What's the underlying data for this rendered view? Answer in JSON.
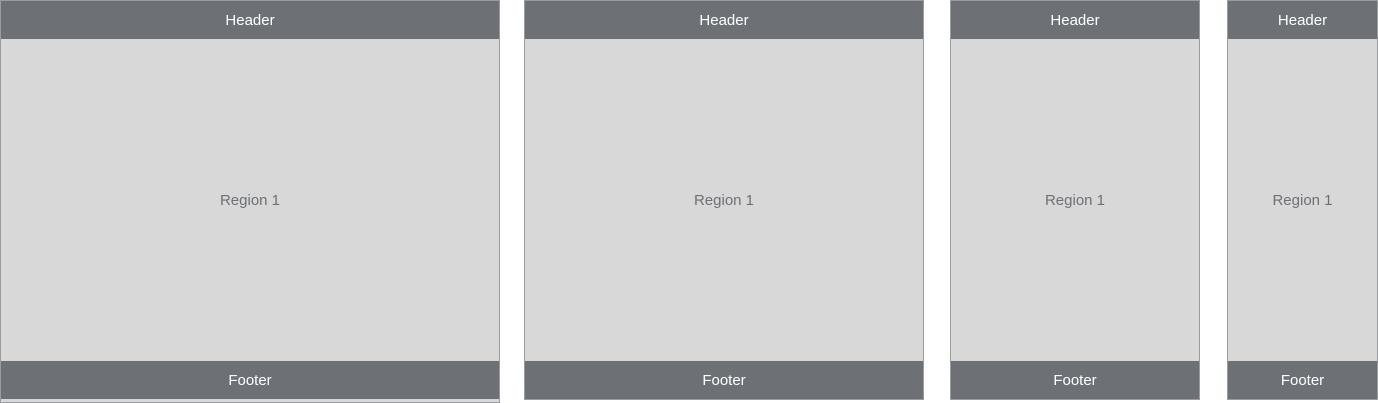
{
  "colors": {
    "bar": "#6d7075",
    "body": "#d8d8d8",
    "border": "#9a9c9f",
    "bar_text": "#ffffff",
    "body_text": "#6d7075"
  },
  "panels": [
    {
      "header": "Header",
      "region": "Region 1",
      "footer": "Footer"
    },
    {
      "header": "Header",
      "region": "Region 1",
      "footer": "Footer"
    },
    {
      "header": "Header",
      "region": "Region 1",
      "footer": "Footer"
    },
    {
      "header": "Header",
      "region": "Region 1",
      "footer": "Footer"
    }
  ]
}
